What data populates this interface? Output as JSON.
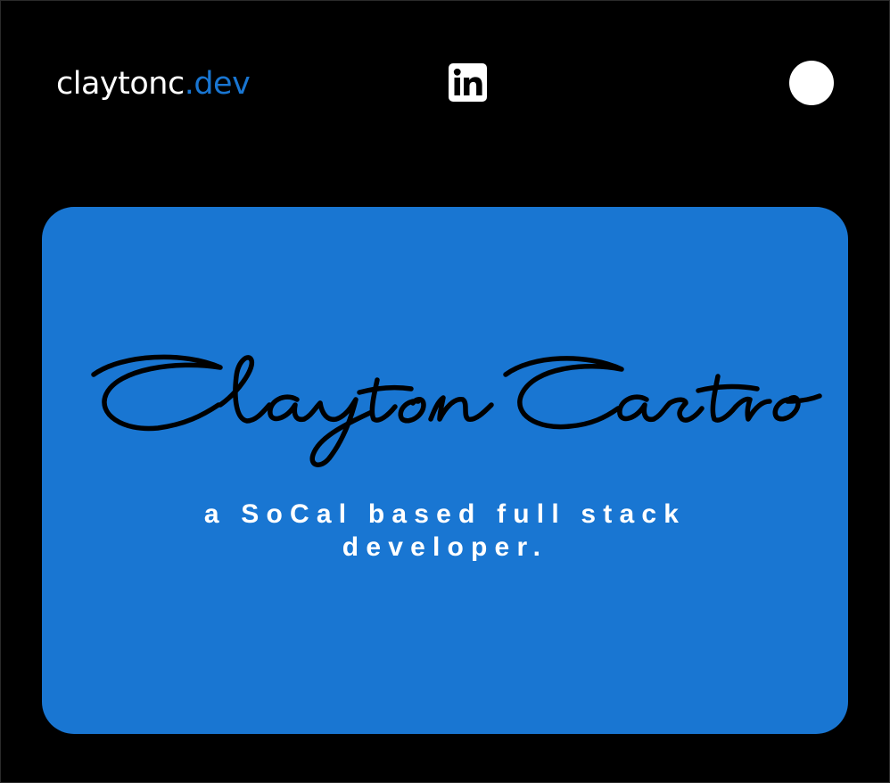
{
  "header": {
    "brand_name": "claytonc",
    "brand_tld": ".dev",
    "linkedin_icon": "linkedin-icon",
    "theme_toggle_icon": "circle-toggle-icon"
  },
  "hero": {
    "signature_name": "Clayton Castro",
    "tagline_line1": "a SoCal based full stack",
    "tagline_line2": "developer."
  },
  "colors": {
    "background": "#000000",
    "accent": "#1976d2",
    "text": "#ffffff",
    "signature_ink": "#000000"
  }
}
